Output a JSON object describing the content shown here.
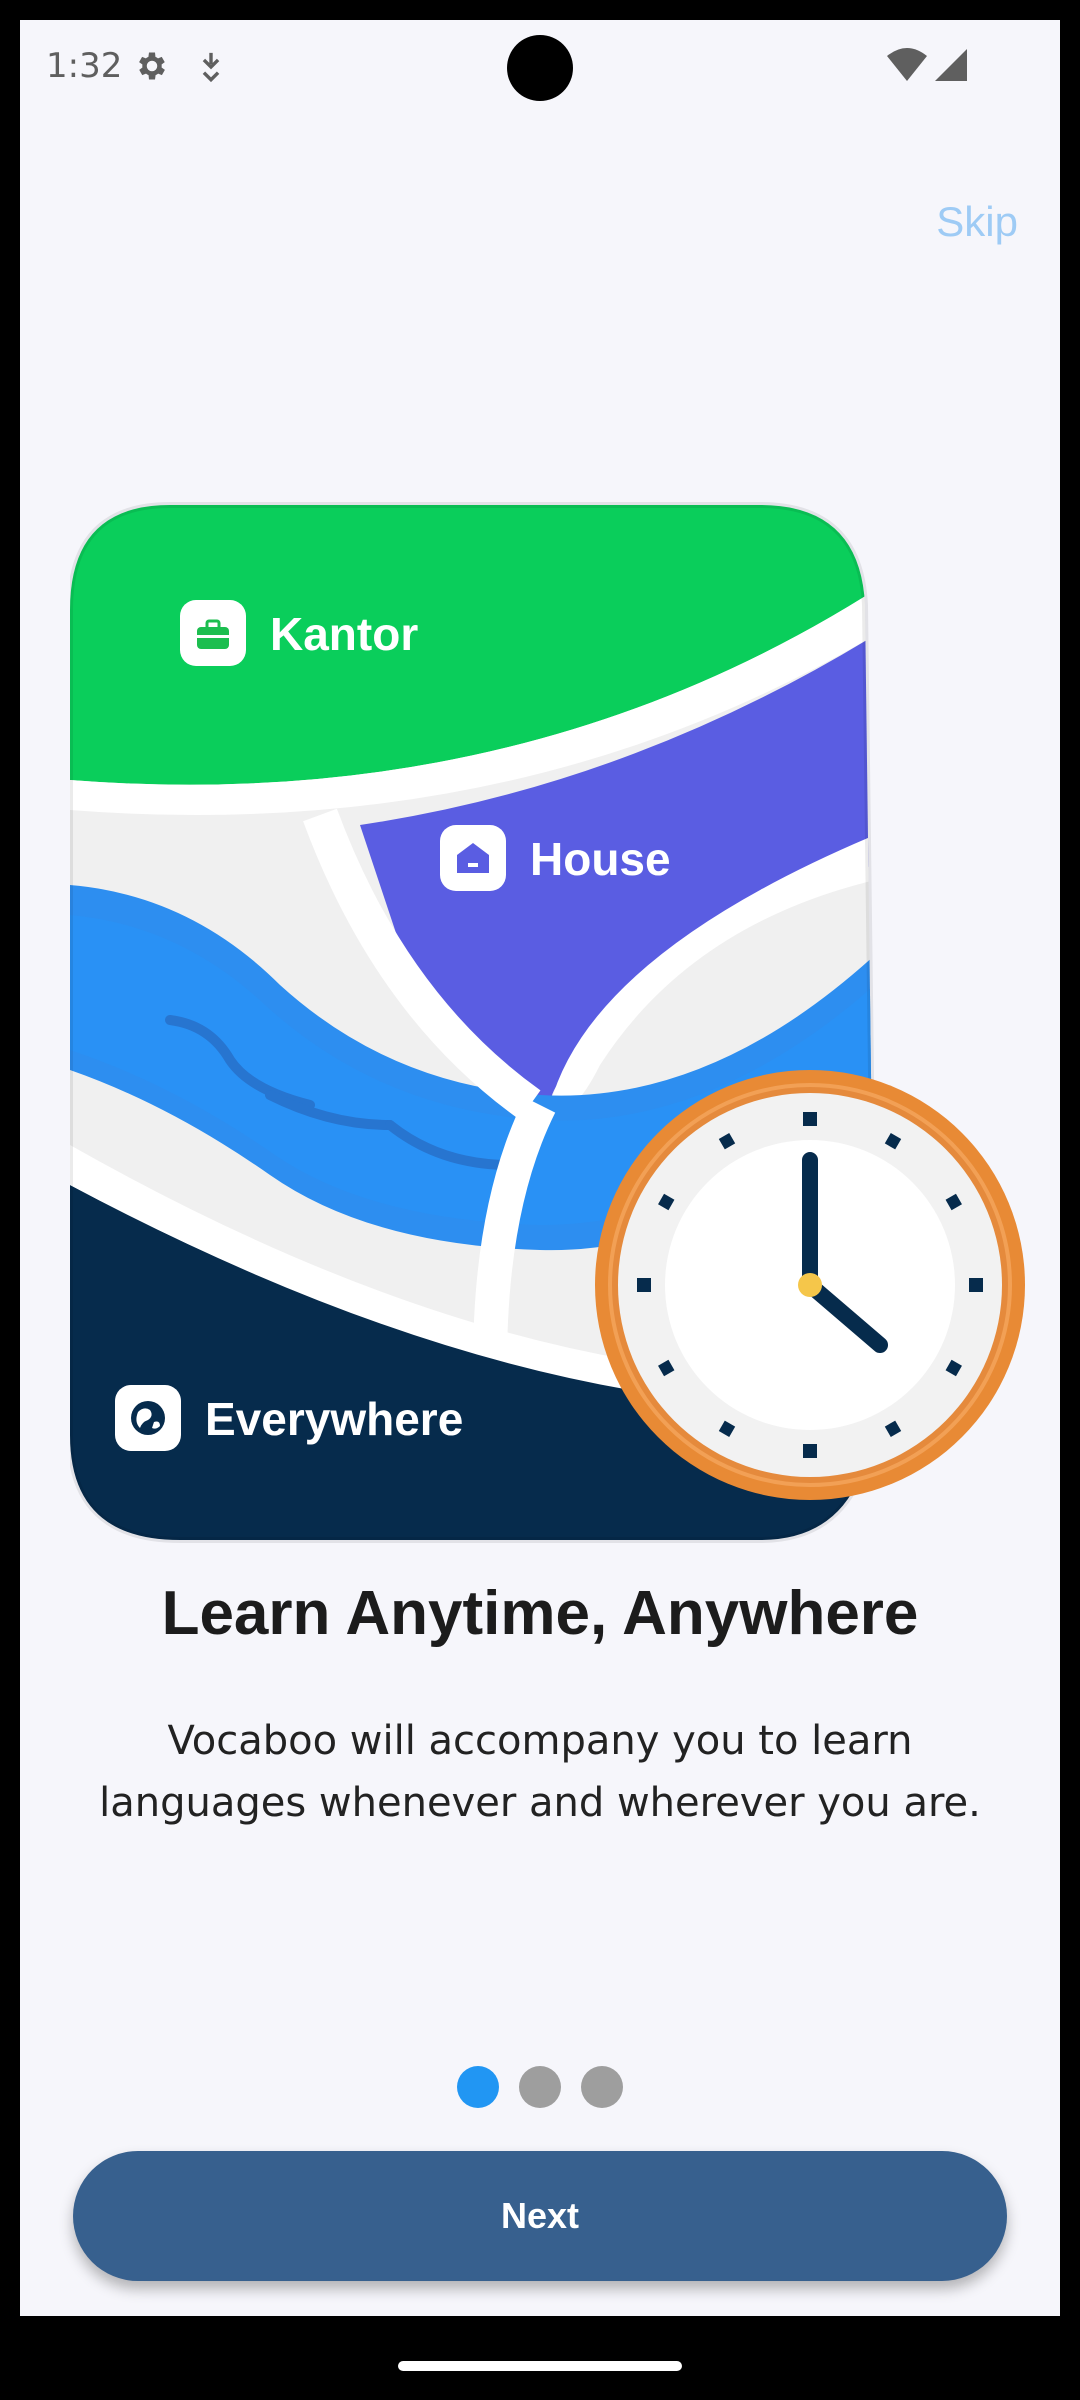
{
  "status_bar": {
    "time": "1:32",
    "icons": [
      "gear-icon",
      "download-icon",
      "wifi-icon",
      "signal-icon"
    ]
  },
  "skip_label": "Skip",
  "illustration": {
    "labels": {
      "kantor": "Kantor",
      "house": "House",
      "everywhere": "Everywhere"
    },
    "icons": [
      "briefcase-icon",
      "house-icon",
      "globe-icon",
      "clock-icon"
    ]
  },
  "title": "Learn Anytime, Anywhere",
  "subtitle": "Vocaboo will accompany you to learn languages whenever and wherever you are.",
  "pager": {
    "total_pages": 3,
    "active_index": 0
  },
  "next_label": "Next",
  "colors": {
    "accent_blue": "#2196F3",
    "button": "#37608E",
    "skip": "#9ECBF5",
    "green": "#0ACE5B",
    "purple": "#5A5DE2",
    "navy": "#062B4C",
    "clock_ring": "#E88A35"
  }
}
